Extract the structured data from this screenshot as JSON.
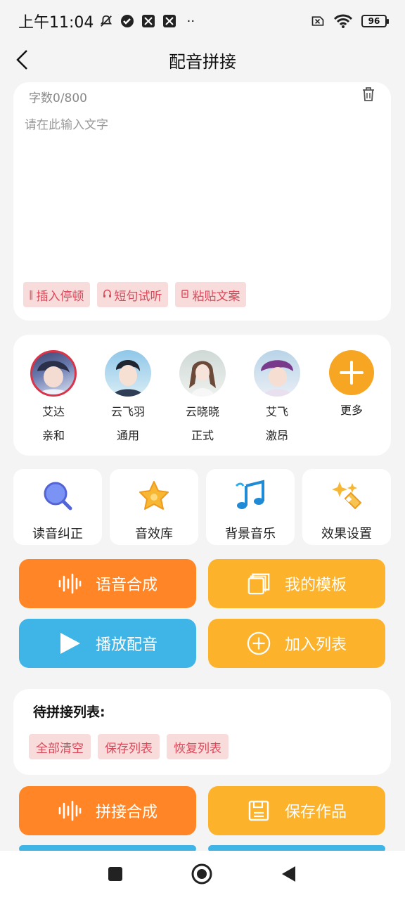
{
  "status_bar": {
    "time": "上午11:04",
    "battery": "96",
    "icons": [
      "mute-icon",
      "check-circle-icon",
      "app-icon",
      "app-icon",
      "more-dots-icon",
      "sim-x-icon",
      "wifi-icon",
      "battery-icon"
    ]
  },
  "header": {
    "title": "配音拼接"
  },
  "editor": {
    "word_count": "字数0/800",
    "placeholder": "请在此输入文字",
    "chips": [
      {
        "icon": "pause-icon",
        "label": "插入停顿"
      },
      {
        "icon": "headphones-icon",
        "label": "短句试听"
      },
      {
        "icon": "paste-icon",
        "label": "粘贴文案"
      }
    ]
  },
  "voices": [
    {
      "name": "艾达",
      "tag": "亲和",
      "selected": true
    },
    {
      "name": "云飞羽",
      "tag": "通用",
      "selected": false
    },
    {
      "name": "云晓晓",
      "tag": "正式",
      "selected": false
    },
    {
      "name": "艾飞",
      "tag": "激昂",
      "selected": false
    },
    {
      "name": "更多",
      "tag": "",
      "selected": false
    }
  ],
  "tools": [
    {
      "icon": "magnifier-icon",
      "label": "读音纠正"
    },
    {
      "icon": "star-icon",
      "label": "音效库"
    },
    {
      "icon": "music-note-icon",
      "label": "背景音乐"
    },
    {
      "icon": "sparkle-wand-icon",
      "label": "效果设置"
    }
  ],
  "actions": {
    "synthesize": "语音合成",
    "my_templates": "我的模板",
    "play": "播放配音",
    "add_to_list": "加入列表"
  },
  "pending": {
    "title": "待拼接列表:",
    "chips": [
      "全部清空",
      "保存列表",
      "恢复列表"
    ]
  },
  "bottom_actions": {
    "merge": "拼接合成",
    "save": "保存作品"
  },
  "colors": {
    "orange": "#ff8526",
    "yellow": "#fcb22a",
    "blue": "#3fb4e6",
    "chip_bg": "#f8dcdc",
    "chip_text": "#d84a5a"
  }
}
